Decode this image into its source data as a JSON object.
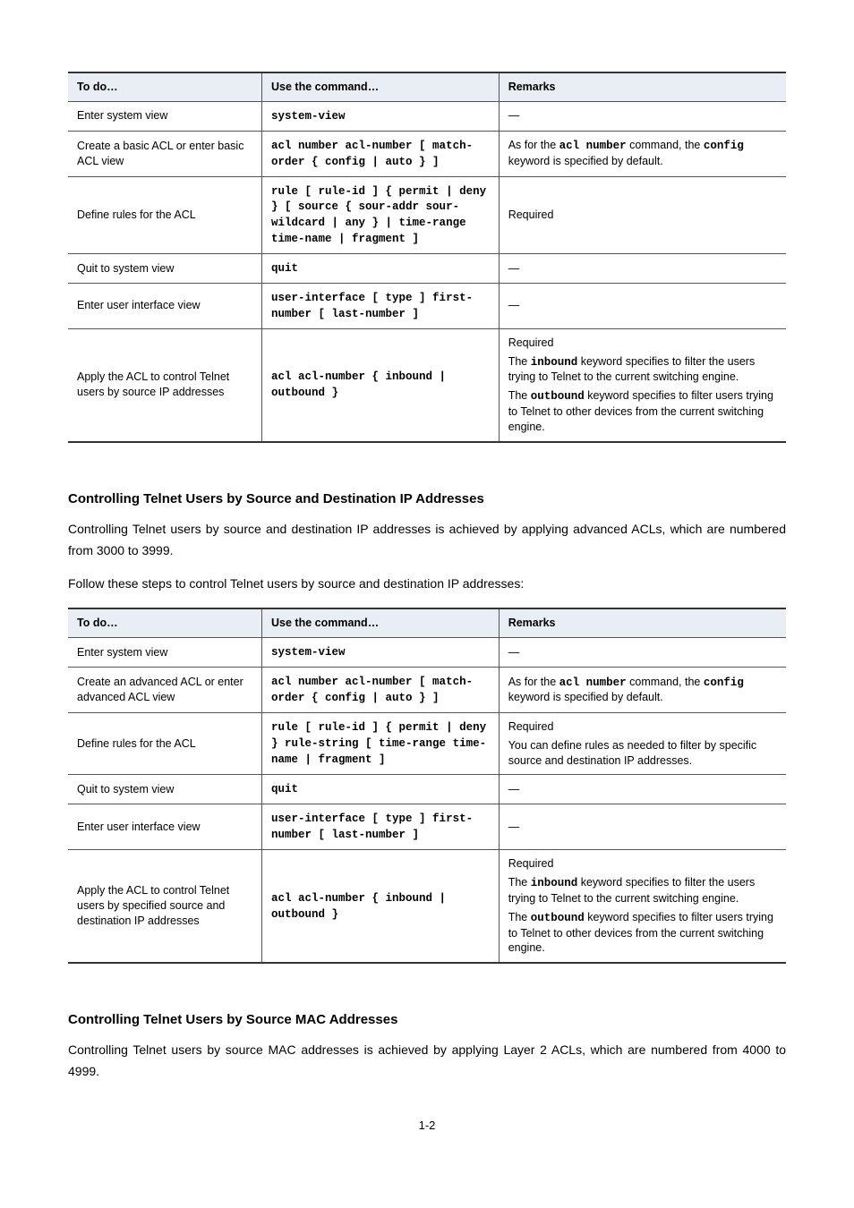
{
  "table1": {
    "headers": {
      "to": "To do…",
      "cmd": "Use the command…",
      "desc": "Remarks"
    },
    "rows": [
      {
        "to": "Enter system view",
        "cmd": "system-view",
        "desc": "—"
      },
      {
        "to": "Create a basic ACL or enter basic ACL view",
        "cmd": "acl number acl-number [ match-order { config | auto } ]",
        "desc_pre": "As for the ",
        "desc_bold": "acl number",
        "desc_mid": " command, the ",
        "desc_bold2": "config",
        "desc_post": " keyword is specified by default."
      },
      {
        "to": "Define rules for the ACL",
        "cmd": "rule [ rule-id ] { permit | deny } [ source { sour-addr sour-wildcard | any } | time-range time-name | fragment ]",
        "desc": "Required"
      },
      {
        "to": "Quit to system view",
        "cmd": "quit",
        "desc": "—"
      },
      {
        "to": "Enter user interface view",
        "cmd": "user-interface [ type ] first-number [ last-number ]",
        "desc": "—"
      },
      {
        "to": "Apply the ACL to control Telnet users by source IP addresses",
        "cmd": "acl acl-number { inbound | outbound }",
        "desc_l1": "Required",
        "desc_l2a": "The ",
        "desc_l2b": "inbound",
        "desc_l2c": " keyword specifies to filter the users trying to Telnet to the current switching engine.",
        "desc_l3a": "The ",
        "desc_l3b": "outbound",
        "desc_l3c": " keyword specifies to filter users trying to Telnet to other devices from the current switching engine."
      }
    ]
  },
  "section2": {
    "title": "Controlling Telnet Users by Source and Destination IP Addresses",
    "para1": "Controlling Telnet users by source and destination IP addresses is achieved by applying advanced ACLs, which are numbered from 3000 to 3999.",
    "para2": "Follow these steps to control Telnet users by source and destination IP addresses:"
  },
  "table2": {
    "headers": {
      "to": "To do…",
      "cmd": "Use the command…",
      "desc": "Remarks"
    },
    "rows": [
      {
        "to": "Enter system view",
        "cmd": "system-view",
        "desc": "—"
      },
      {
        "to": "Create an advanced ACL or enter advanced ACL view",
        "cmd": "acl number acl-number [ match-order { config | auto } ]",
        "desc_pre": "As for the ",
        "desc_bold": "acl number",
        "desc_mid": " command, the ",
        "desc_bold2": "config",
        "desc_post": " keyword is specified by default."
      },
      {
        "to": "Define rules for the ACL",
        "cmd": "rule [ rule-id ] { permit | deny } rule-string [ time-range time-name | fragment ]",
        "desc_l1": "Required",
        "desc_l2": "You can define rules as needed to filter by specific source and destination IP addresses."
      },
      {
        "to": "Quit to system view",
        "cmd": "quit",
        "desc": "—"
      },
      {
        "to": "Enter user interface view",
        "cmd": "user-interface [ type ] first-number [ last-number ]",
        "desc": "—"
      },
      {
        "to": "Apply the ACL to control Telnet users by specified source and destination IP addresses",
        "cmd": "acl acl-number { inbound | outbound }",
        "desc_l1": "Required",
        "desc_l2a": "The ",
        "desc_l2b": "inbound",
        "desc_l2c": " keyword specifies to filter the users trying to Telnet to the current switching engine.",
        "desc_l3a": "The ",
        "desc_l3b": "outbound",
        "desc_l3c": " keyword specifies to filter users trying to Telnet to other devices from the current switching engine."
      }
    ]
  },
  "section3": {
    "title": "Controlling Telnet Users by Source MAC Addresses",
    "para1": "Controlling Telnet users by source MAC addresses is achieved by applying Layer 2 ACLs, which are numbered from 4000 to 4999."
  },
  "page_number": "1-2"
}
